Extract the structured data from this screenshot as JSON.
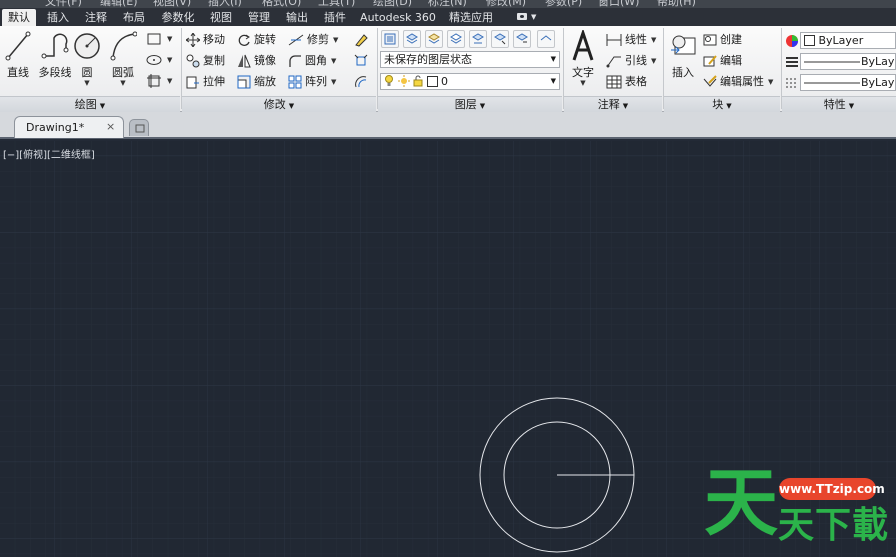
{
  "menubar": [
    "文件(F)",
    "编辑(E)",
    "视图(V)",
    "插入(I)",
    "格式(O)",
    "工具(T)",
    "绘图(D)",
    "标注(N)",
    "修改(M)",
    "参数(P)",
    "窗口(W)",
    "帮助(H)"
  ],
  "tabs": [
    "默认",
    "插入",
    "注释",
    "布局",
    "参数化",
    "视图",
    "管理",
    "输出",
    "插件",
    "Autodesk 360",
    "精选应用"
  ],
  "active_tab": "默认",
  "draw": {
    "title": "绘图",
    "line": "直线",
    "polyline": "多段线",
    "circle": "圆",
    "arc": "圆弧"
  },
  "modify": {
    "title": "修改",
    "move": "移动",
    "rotate": "旋转",
    "trim": "修剪",
    "copy": "复制",
    "mirror": "镜像",
    "fillet": "圆角",
    "stretch": "拉伸",
    "scale": "缩放",
    "array": "阵列"
  },
  "layers": {
    "title": "图层",
    "state": "未保存的图层状态",
    "current": "0"
  },
  "annotation": {
    "title": "注释",
    "text": "文字",
    "linear": "线性",
    "leader": "引线",
    "table": "表格"
  },
  "block": {
    "title": "块",
    "insert": "插入",
    "create": "创建",
    "edit": "编辑",
    "edit_attr": "编辑属性"
  },
  "properties": {
    "title": "特性",
    "color": "ByLayer",
    "linetype": "ByLayer",
    "lineweight": "ByLayer"
  },
  "document": {
    "tab": "Drawing1*",
    "close": "×"
  },
  "viewport": {
    "label": "[−][俯视][二维线框]"
  },
  "colors": {
    "canvas": "#212833",
    "ribbon": "#f0f0f0",
    "tabbar": "#2c3038",
    "watermark_green": "#2bb34a",
    "watermark_red": "#e8452c"
  },
  "watermark": {
    "url": "www.TTzip.com",
    "big": "天",
    "rest": "天下載"
  }
}
